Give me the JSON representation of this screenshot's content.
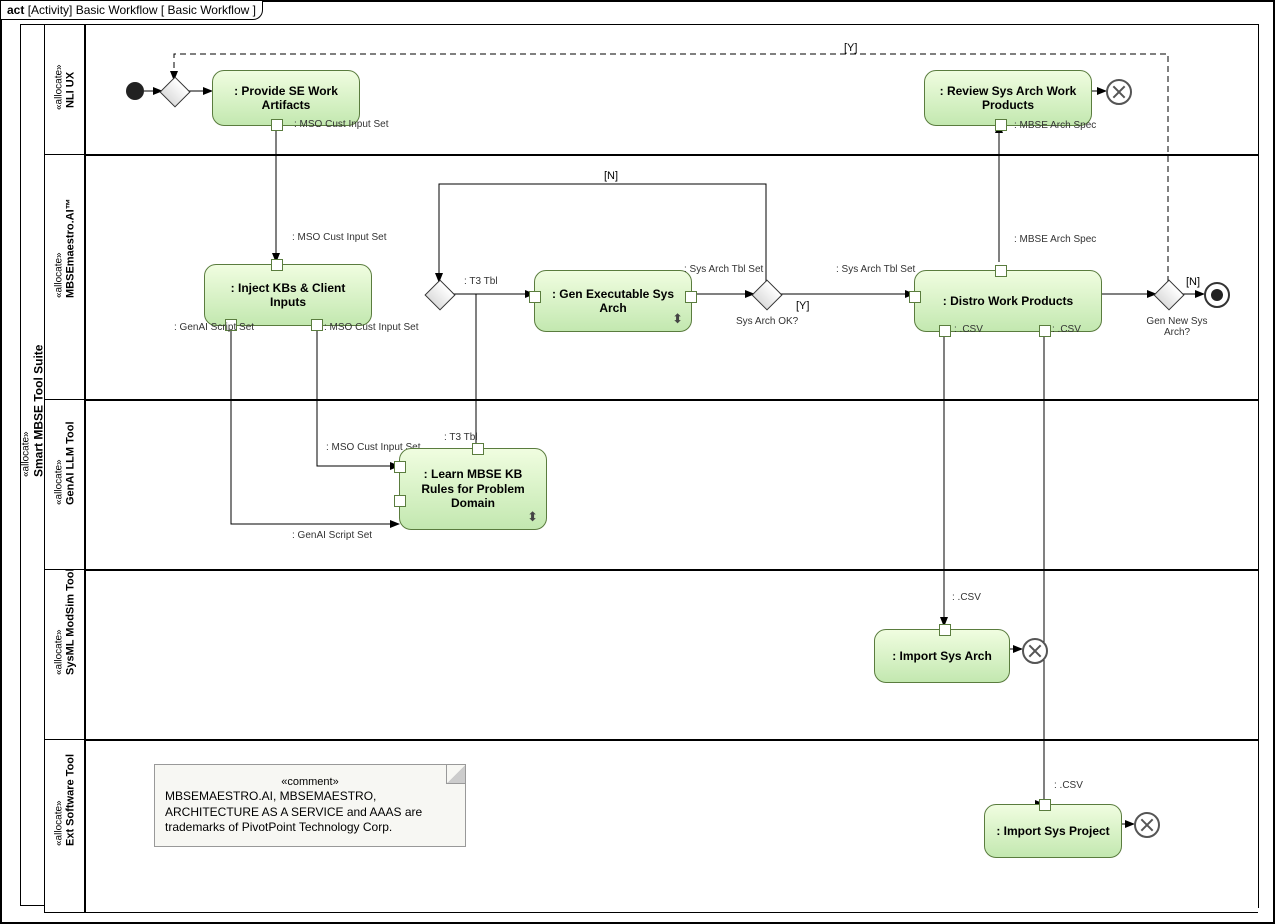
{
  "header": {
    "kind": "act",
    "bracket": "[Activity]",
    "name": "Basic Workflow",
    "param": "[ Basic Workflow ]"
  },
  "outerLane": {
    "stereo": "«allocate»",
    "name": "Smart MBSE Tool Suite"
  },
  "lanes": [
    {
      "stereo": "«allocate»",
      "name": "NLI UX"
    },
    {
      "stereo": "«allocate»",
      "name": "MBSEmaestro.AI™"
    },
    {
      "stereo": "«allocate»",
      "name": "GenAI LLM Tool"
    },
    {
      "stereo": "«allocate»",
      "name": "SysML ModSim Tool"
    },
    {
      "stereo": "«allocate»",
      "name": "Ext Software Tool"
    }
  ],
  "activities": {
    "provide": ": Provide SE Work Artifacts",
    "review": ": Review Sys Arch Work Products",
    "inject": ": Inject KBs & Client Inputs",
    "genExec": ": Gen Executable Sys Arch",
    "distro": ": Distro Work Products",
    "learn": ": Learn MBSE KB Rules for Problem Domain",
    "importArch": ": Import Sys Arch",
    "importProj": ": Import Sys Project"
  },
  "pins": {
    "msoCustInput": ": MSO Cust Input Set",
    "genAIScript": ": GenAI Script Set",
    "tTbl": ": T3 Tbl",
    "sysArchTbl": ": Sys Arch Tbl Set",
    "mbseArchSpec": ": MBSE Arch Spec",
    "csv": ": .CSV"
  },
  "decisions": {
    "sysArchOK": "Sys Arch OK?",
    "genNew": "Gen New Sys Arch?"
  },
  "guards": {
    "yes": "[Y]",
    "no": "[N]"
  },
  "comment": {
    "stereo": "«comment»",
    "text": "MBSEMAESTRO.AI, MBSEMAESTRO, ARCHITECTURE AS A SERVICE and AAAS are trademarks of PivotPoint Technology Corp."
  }
}
